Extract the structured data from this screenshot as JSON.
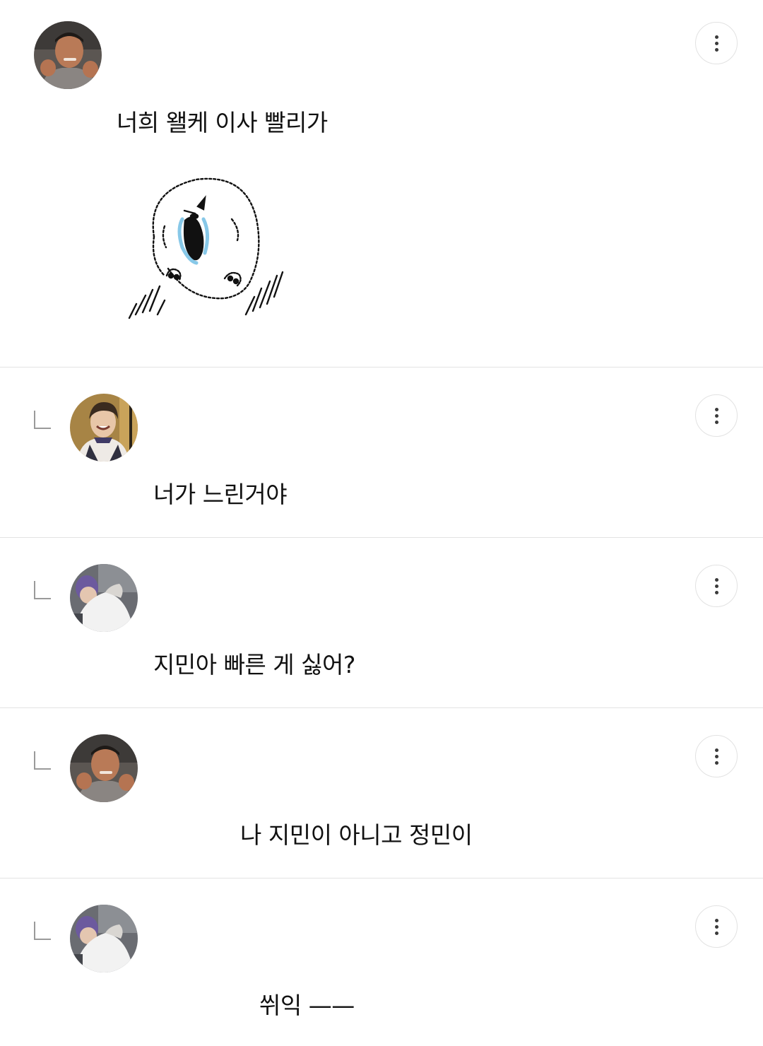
{
  "comments": [
    {
      "is_reply": false,
      "avatar": "avatar-man-fists",
      "text": "너희 왤케 이사 빨리가",
      "has_sticker": true,
      "sticker": "crying-fluffy-dog-sticker",
      "menu_icon": "more-vertical-icon"
    },
    {
      "is_reply": true,
      "avatar": "avatar-smiling-person",
      "text": "너가 느린거야",
      "menu_icon": "more-vertical-icon"
    },
    {
      "is_reply": true,
      "avatar": "avatar-person-white-shirt",
      "text": "지민아 빠른 게 싫어?",
      "menu_icon": "more-vertical-icon"
    },
    {
      "is_reply": true,
      "avatar": "avatar-man-fists",
      "text": "나 지민이 아니고 정민이",
      "menu_icon": "more-vertical-icon"
    },
    {
      "is_reply": true,
      "avatar": "avatar-person-white-shirt",
      "text": "쒸익 ——",
      "menu_icon": "more-vertical-icon"
    }
  ],
  "colors": {
    "divider": "#e3e3e3",
    "text": "#111111",
    "reply_mark": "#9a9a9a"
  }
}
